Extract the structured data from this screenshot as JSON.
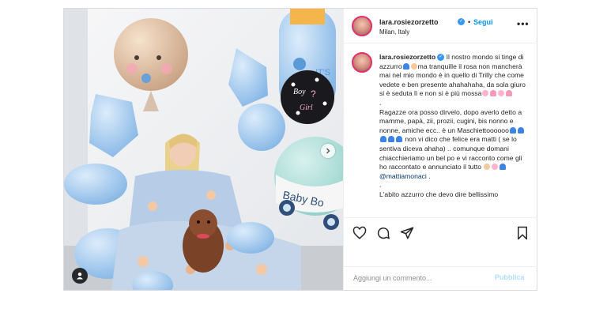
{
  "post": {
    "username": "lara.rosiezorzetto",
    "location": "Milan, Italy",
    "follow_label": "Segui",
    "separator": "•",
    "verified_glyph": "✓",
    "more_glyph": "•••",
    "caption": {
      "username": "lara.rosiezorzetto",
      "p1": "Il nostro mondo si tinge di azzurro",
      "p1b": "ma tranquille il rosa non mancherà mai nel mio mondo è in quello di Trilly che come vedete e ben presente ahahahaha, da sola giuro si è seduta lì e non si è più mossa",
      "dot1": ".",
      "p2": "Ragazze ora posso dirvelo, dopo averlo detto a mamme, papà, zii, prozii, cugini, bis nonno e nonne, amiche ecc.. è un Maschiettoooooo",
      "p2b": "non vi dico che felice era matti ( se lo sentiva diceva ahaha) .. comunque domani chiacchieriamo un bel po e vi racconto come gli ho raccontato e annunciato il tutto",
      "mention": "@mattiamonaci",
      "p2c": " .",
      "dot2": ".",
      "p3": "L'abito azzurro che devo dire bellissimo"
    },
    "balloon_text": {
      "baby_boy": "Baby Bo",
      "boy": "Boy",
      "or": "?",
      "girl": "Girl",
      "its": "IT'S"
    },
    "actions": [
      "heart-icon",
      "comment-icon",
      "share-icon",
      "bookmark-icon"
    ],
    "comment_placeholder": "Aggiungi un commento...",
    "publish_label": "Pubblica",
    "colors": {
      "accent": "#0095f6",
      "publish_disabled": "#b2dffc",
      "balloon_blue": "#a9cdef",
      "mention": "#00376b"
    }
  }
}
